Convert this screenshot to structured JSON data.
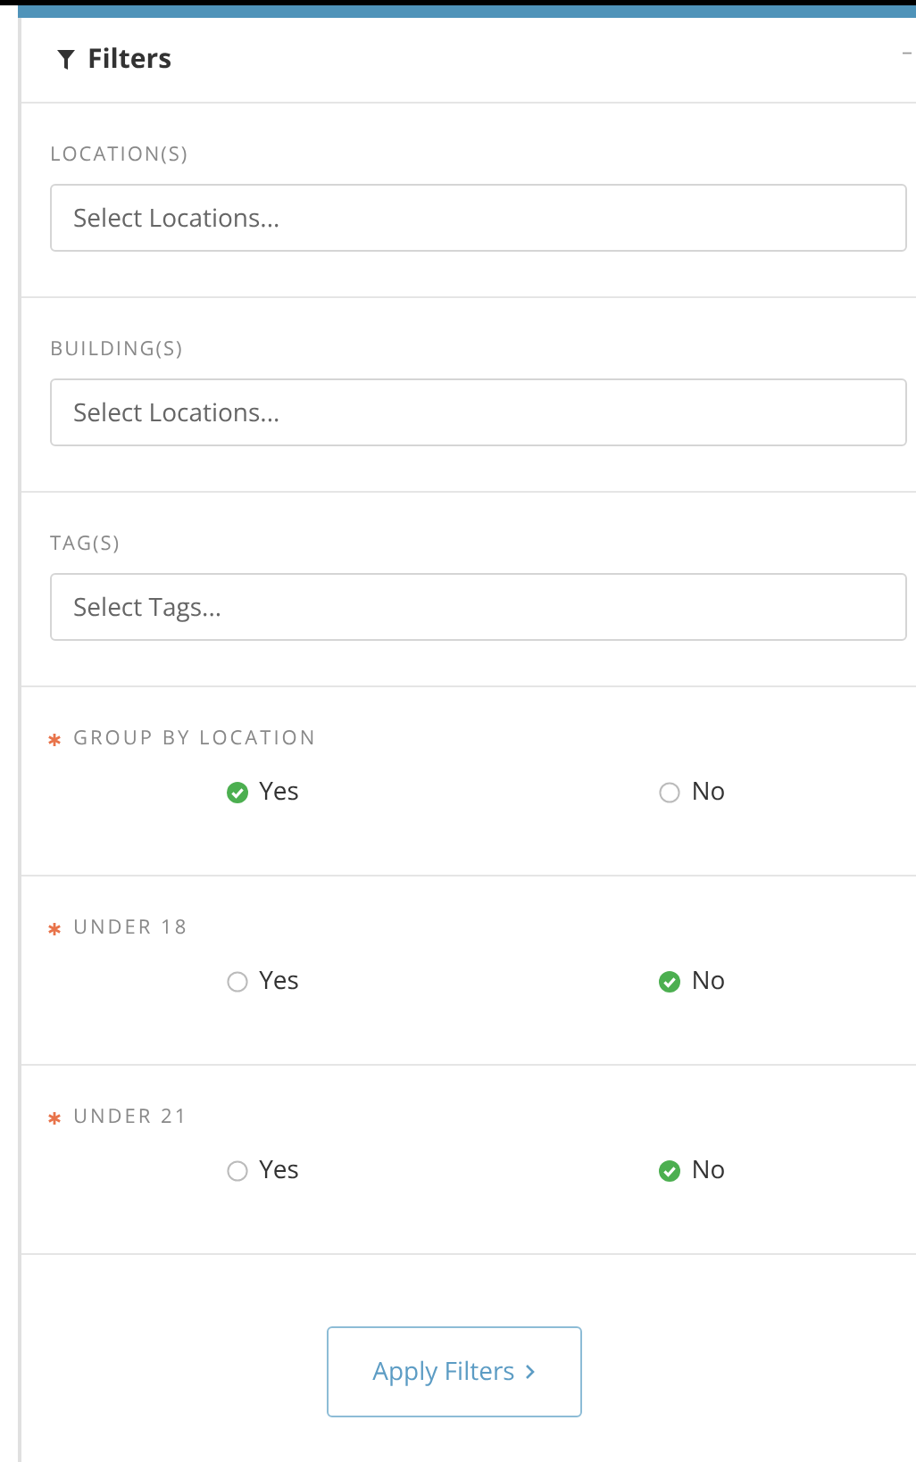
{
  "panel": {
    "title": "Filters",
    "collapse": "–"
  },
  "selects": [
    {
      "label": "LOCATION(S)",
      "placeholder": "Select Locations..."
    },
    {
      "label": "BUILDING(S)",
      "placeholder": "Select Locations..."
    },
    {
      "label": "TAG(S)",
      "placeholder": "Select Tags..."
    }
  ],
  "questions": [
    {
      "label": "GROUP BY LOCATION",
      "required": true,
      "options": [
        {
          "label": "Yes",
          "selected": true
        },
        {
          "label": "No",
          "selected": false
        }
      ]
    },
    {
      "label": "UNDER 18",
      "required": true,
      "options": [
        {
          "label": "Yes",
          "selected": false
        },
        {
          "label": "No",
          "selected": true
        }
      ]
    },
    {
      "label": "UNDER 21",
      "required": true,
      "options": [
        {
          "label": "Yes",
          "selected": false
        },
        {
          "label": "No",
          "selected": true
        }
      ]
    }
  ],
  "apply_button": "Apply Filters"
}
